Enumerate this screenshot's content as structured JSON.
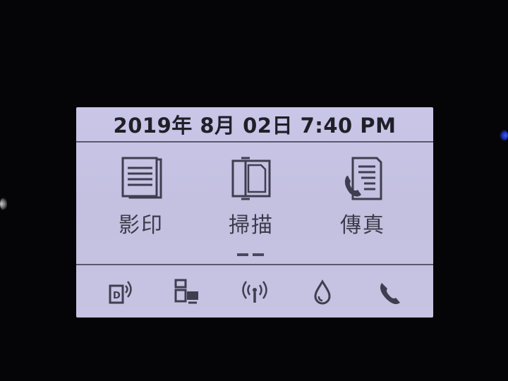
{
  "header": {
    "datetime": "2019年 8月 02日 7:40 PM"
  },
  "functions": [
    {
      "id": "copy",
      "label": "影印",
      "icon": "copy-document-icon"
    },
    {
      "id": "scan",
      "label": "掃描",
      "icon": "scan-document-icon"
    },
    {
      "id": "fax",
      "label": "傳真",
      "icon": "fax-document-icon"
    }
  ],
  "page_indicator": {
    "pages": 2,
    "current": 1
  },
  "status_bar": [
    {
      "id": "wifi-direct",
      "icon": "wifi-direct-icon"
    },
    {
      "id": "network",
      "icon": "network-printer-icon"
    },
    {
      "id": "wireless",
      "icon": "wireless-signal-icon"
    },
    {
      "id": "ink",
      "icon": "ink-drop-icon"
    },
    {
      "id": "fax-status",
      "icon": "phone-handset-icon"
    }
  ],
  "colors": {
    "screen_bg": "#c6c3e3",
    "text_dark": "#1f1f28",
    "icon": "#3e3e50",
    "bezel": "#050507",
    "status_led": "#3a5cff"
  }
}
